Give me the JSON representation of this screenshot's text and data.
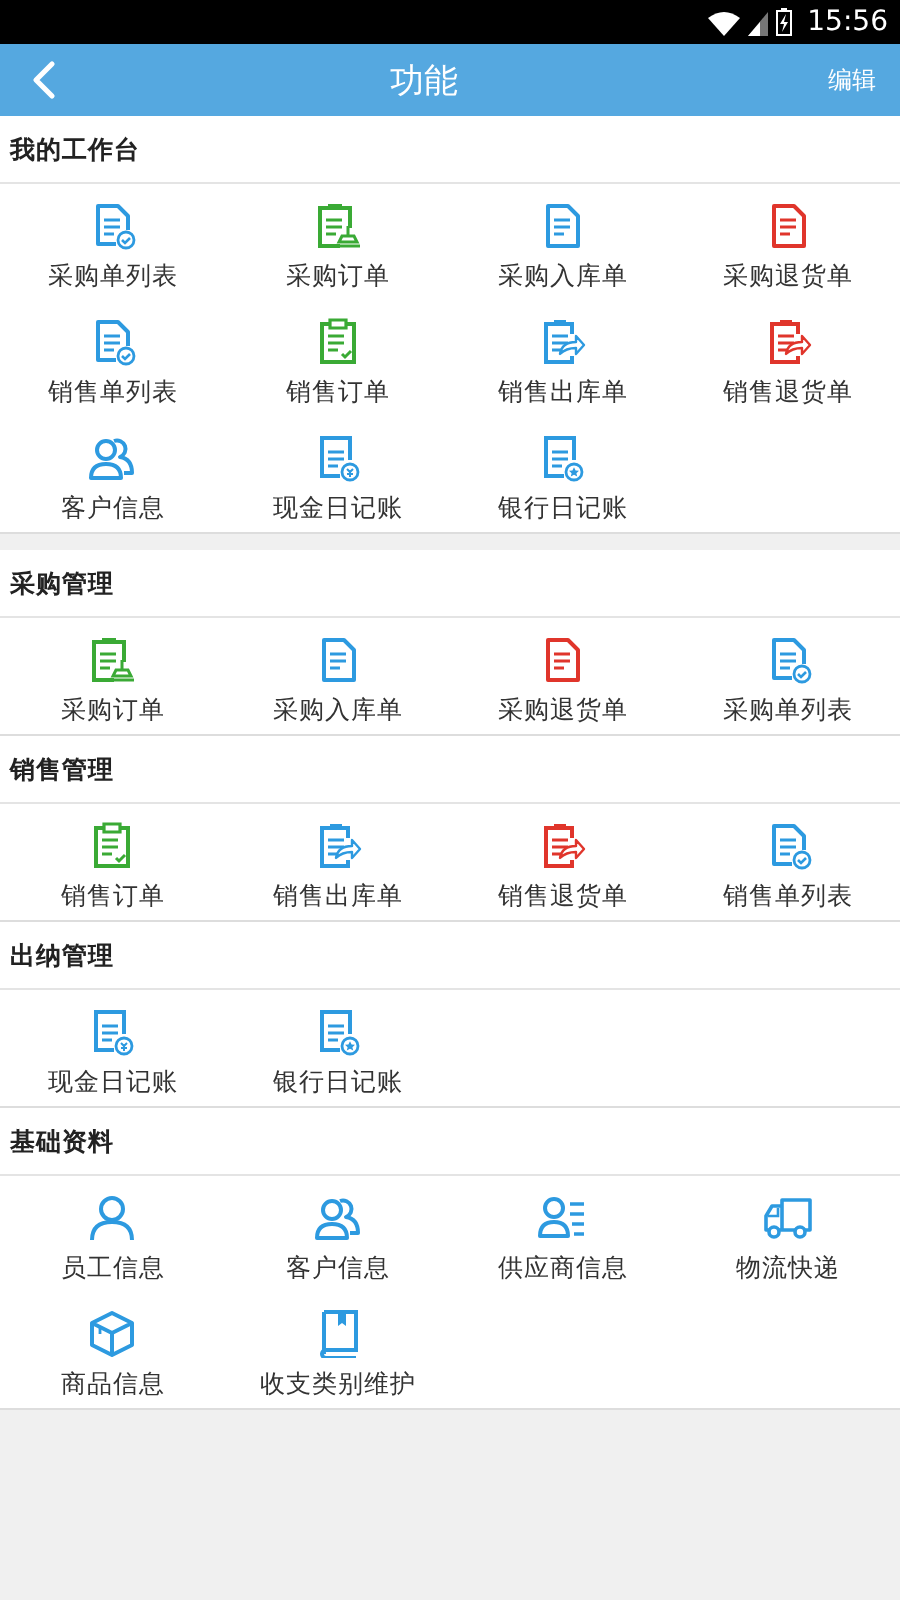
{
  "status_bar": {
    "time": "15:56"
  },
  "header": {
    "title": "功能",
    "action": "编辑"
  },
  "sections": [
    {
      "title": "我的工作台",
      "items": [
        {
          "label": "采购单列表",
          "kind": "doc-check",
          "color": "#2d9ae0"
        },
        {
          "label": "采购订单",
          "kind": "clipboard-stamp",
          "color": "#3aaa35"
        },
        {
          "label": "采购入库单",
          "kind": "doc",
          "color": "#2d9ae0"
        },
        {
          "label": "采购退货单",
          "kind": "doc",
          "color": "#e0352b"
        },
        {
          "label": "销售单列表",
          "kind": "doc-check",
          "color": "#2d9ae0"
        },
        {
          "label": "销售订单",
          "kind": "clipboard-check",
          "color": "#3aaa35"
        },
        {
          "label": "销售出库单",
          "kind": "clipboard-share",
          "color": "#2d9ae0"
        },
        {
          "label": "销售退货单",
          "kind": "clipboard-share",
          "color": "#e0352b"
        },
        {
          "label": "客户信息",
          "kind": "people",
          "color": "#2d9ae0"
        },
        {
          "label": "现金日记账",
          "kind": "doc-coin",
          "color": "#2d9ae0"
        },
        {
          "label": "银行日记账",
          "kind": "doc-star",
          "color": "#2d9ae0"
        }
      ]
    },
    {
      "title": "采购管理",
      "items": [
        {
          "label": "采购订单",
          "kind": "clipboard-stamp",
          "color": "#3aaa35"
        },
        {
          "label": "采购入库单",
          "kind": "doc",
          "color": "#2d9ae0"
        },
        {
          "label": "采购退货单",
          "kind": "doc",
          "color": "#e0352b"
        },
        {
          "label": "采购单列表",
          "kind": "doc-check",
          "color": "#2d9ae0"
        }
      ]
    },
    {
      "title": "销售管理",
      "items": [
        {
          "label": "销售订单",
          "kind": "clipboard-check",
          "color": "#3aaa35"
        },
        {
          "label": "销售出库单",
          "kind": "clipboard-share",
          "color": "#2d9ae0"
        },
        {
          "label": "销售退货单",
          "kind": "clipboard-share",
          "color": "#e0352b"
        },
        {
          "label": "销售单列表",
          "kind": "doc-check",
          "color": "#2d9ae0"
        }
      ]
    },
    {
      "title": "出纳管理",
      "items": [
        {
          "label": "现金日记账",
          "kind": "doc-coin",
          "color": "#2d9ae0"
        },
        {
          "label": "银行日记账",
          "kind": "doc-star",
          "color": "#2d9ae0"
        }
      ]
    },
    {
      "title": "基础资料",
      "items": [
        {
          "label": "员工信息",
          "kind": "person",
          "color": "#2d9ae0"
        },
        {
          "label": "客户信息",
          "kind": "people",
          "color": "#2d9ae0"
        },
        {
          "label": "供应商信息",
          "kind": "person-list",
          "color": "#2d9ae0"
        },
        {
          "label": "物流快递",
          "kind": "truck",
          "color": "#2d9ae0"
        },
        {
          "label": "商品信息",
          "kind": "box",
          "color": "#2d9ae0"
        },
        {
          "label": "收支类别维护",
          "kind": "book",
          "color": "#2d9ae0"
        }
      ]
    }
  ]
}
